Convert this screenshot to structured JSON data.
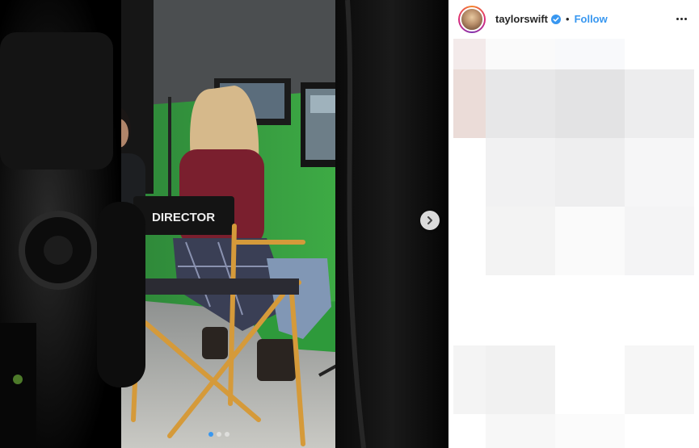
{
  "post": {
    "username": "taylorswift",
    "separator": "•",
    "follow_label": "Follow",
    "verified_color": "#3897f0",
    "director_chair_label": "DIRECTOR"
  },
  "carousel": {
    "slide_count": 3,
    "active_slide": 1,
    "active_dot_color": "#3897f0"
  },
  "icons": {
    "next": "chevron-right-icon",
    "verified": "verified-badge-icon",
    "more": "more-options-icon"
  }
}
